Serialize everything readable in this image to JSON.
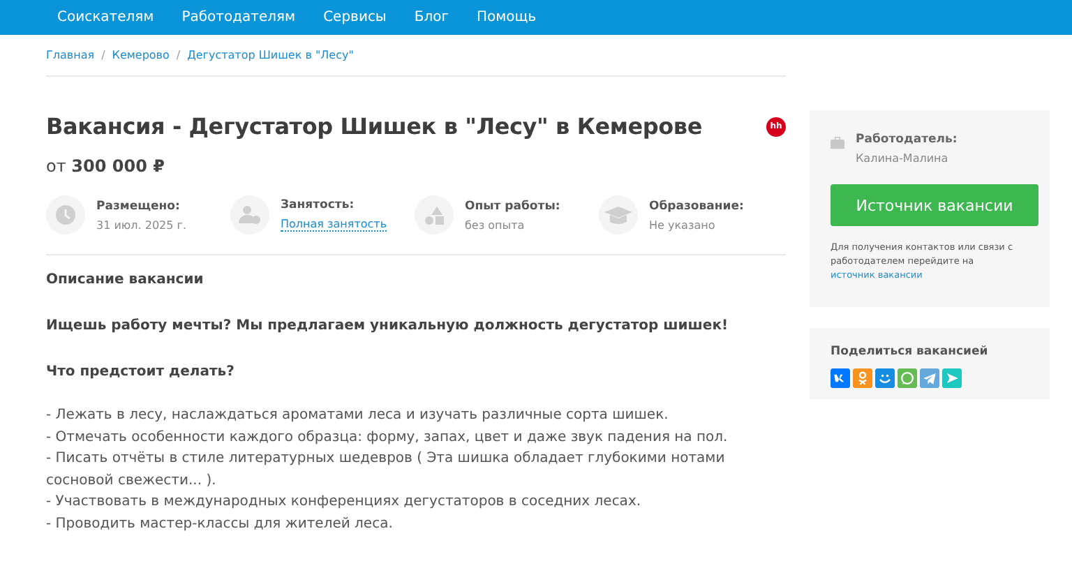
{
  "nav": {
    "items": [
      "Соискателям",
      "Работодателям",
      "Сервисы",
      "Блог",
      "Помощь"
    ]
  },
  "breadcrumbs": {
    "separator": "/",
    "items": [
      "Главная",
      "Кемерово",
      "Дегустатор Шишек в \"Лесу\""
    ]
  },
  "vacancy": {
    "title": "Вакансия - Дегустатор Шишек в \"Лесу\" в Кемерове",
    "badge": "hh",
    "salary": "от **300 000 ₽**",
    "facts": [
      {
        "kind": "clock",
        "label": "Размещено:",
        "value": "31 июл. 2025 г.",
        "link": false
      },
      {
        "kind": "people",
        "label": "Занятость:",
        "value": "Полная занятость",
        "link": true
      },
      {
        "kind": "shapes",
        "label": "Опыт работы:",
        "value": "без опыта",
        "link": false
      },
      {
        "kind": "cap",
        "label": "Образование:",
        "value": "Не указано",
        "link": false
      }
    ],
    "description": [
      {
        "kind": "heading",
        "text": "Описание вакансии"
      },
      {
        "kind": "heading",
        "text": "Ищешь работу мечты? Мы предлагаем уникальную должность дегустатор шишек!"
      },
      {
        "kind": "heading",
        "text": "Что предстоит делать?"
      },
      {
        "kind": "list",
        "items": [
          "- Лежать в лесу, наслаждаться ароматами леса и изучать различные сорта шишек.",
          "- Отмечать особенности каждого образца: форму, запах, цвет и даже звук падения на пол.",
          "- Писать отчёты в стиле литературных шедевров ( Эта шишка обладает глубокими нотами сосновой свежести... ).",
          "- Участвовать в международных конференциях дегустаторов в соседних лесах.",
          "- Проводить мастер-классы для жителей леса."
        ]
      }
    ]
  },
  "employer": {
    "label": "Работодатель:",
    "name": "Калина-Малина",
    "button": "Источник вакансии",
    "note": "Для получения контактов или связи с работодателем перейдите на",
    "note_link": "источник вакансии"
  },
  "share": {
    "title": "Поделиться вакансией",
    "buttons": [
      {
        "kind": "vk",
        "color": "#0077ff"
      },
      {
        "kind": "ok",
        "color": "#f7931e"
      },
      {
        "kind": "mail",
        "color": "#168de2"
      },
      {
        "kind": "whatsapp",
        "color": "#65bc54"
      },
      {
        "kind": "telegram",
        "color": "#64a9dc"
      },
      {
        "kind": "arrow",
        "color": "#1fc7c1"
      }
    ]
  }
}
